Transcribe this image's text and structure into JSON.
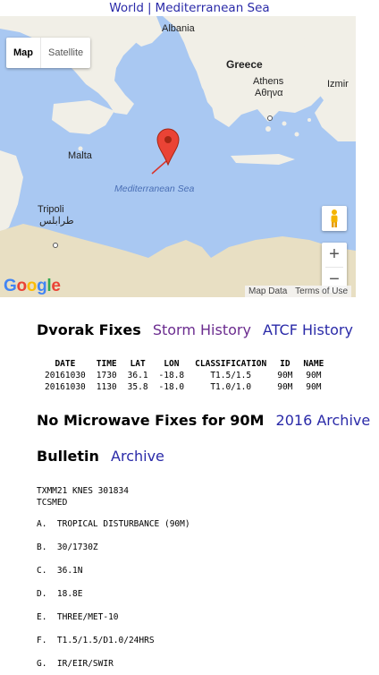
{
  "breadcrumb": {
    "world": "World",
    "separator": "|",
    "region": "Mediterranean Sea"
  },
  "map": {
    "type_control": {
      "map": "Map",
      "satellite": "Satellite"
    },
    "labels": {
      "albania": "Albania",
      "greece": "Greece",
      "athens": "Athens",
      "athens_native": "Αθηνα",
      "izmir": "Izmir",
      "malta": "Malta",
      "sea": "Mediterranean Sea",
      "tripoli": "Tripoli",
      "tripoli_native": "طرابلس"
    },
    "zoom_in": "+",
    "zoom_out": "−",
    "logo": "Google",
    "attribution": {
      "map_data": "Map Data",
      "terms": "Terms of Use"
    },
    "colors": {
      "sea": "#a9c8f2",
      "land": "#f1efe7",
      "desert": "#e8dfc3",
      "marker": "#d9342b"
    }
  },
  "dvorak": {
    "heading": "Dvorak Fixes",
    "storm_history": "Storm History",
    "atcf_history": "ATCF History",
    "columns": [
      "DATE",
      "TIME",
      "LAT",
      "LON",
      "CLASSIFICATION",
      "ID",
      "NAME"
    ],
    "rows": [
      [
        "20161030",
        "1730",
        "36.1",
        "-18.8",
        "T1.5/1.5",
        "90M",
        "90M"
      ],
      [
        "20161030",
        "1130",
        "35.8",
        "-18.0",
        "T1.0/1.0",
        "90M",
        "90M"
      ]
    ]
  },
  "microwave": {
    "heading": "No Microwave Fixes for 90M",
    "archive": "2016 Archive"
  },
  "bulletin": {
    "heading": "Bulletin",
    "archive": "Archive",
    "header_line1": "TXMM21 KNES 301834",
    "header_line2": "TCSMED",
    "items": [
      "A.  TROPICAL DISTURBANCE (90M)",
      "B.  30/1730Z",
      "C.  36.1N",
      "D.  18.8E",
      "E.  THREE/MET-10",
      "F.  T1.5/1.5/D1.0/24HRS",
      "G.  IR/EIR/SWIR"
    ]
  }
}
